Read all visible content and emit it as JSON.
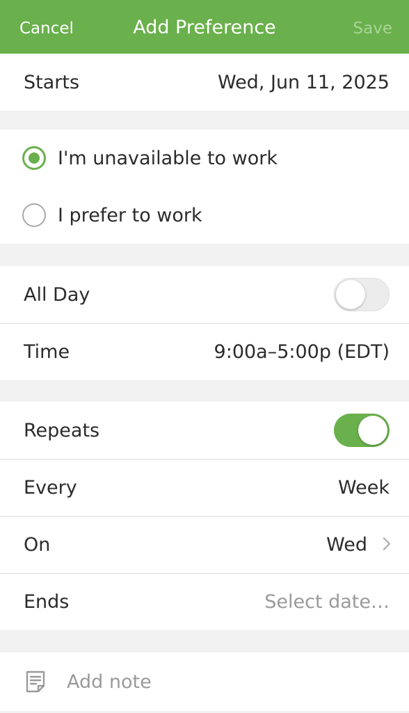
{
  "nav": {
    "cancel_label": "Cancel",
    "title": "Add Preference",
    "save_label": "Save",
    "bar_color": "#6ab04c"
  },
  "start": {
    "label": "Starts",
    "value": "Wed, Jun 11, 2025"
  },
  "availability": {
    "options": [
      {
        "label": "I'm unavailable to work",
        "selected": true
      },
      {
        "label": "I prefer to work",
        "selected": false
      }
    ]
  },
  "timing": {
    "all_day_label": "All Day",
    "all_day_on": false,
    "time_label": "Time",
    "time_value": "9:00a–5:00p (EDT)"
  },
  "repeat": {
    "repeats_label": "Repeats",
    "repeats_on": true,
    "every_label": "Every",
    "every_value": "Week",
    "on_label": "On",
    "on_value": "Wed",
    "ends_label": "Ends",
    "ends_placeholder": "Select date…"
  },
  "note": {
    "placeholder": "Add note",
    "icon": "note-icon"
  }
}
